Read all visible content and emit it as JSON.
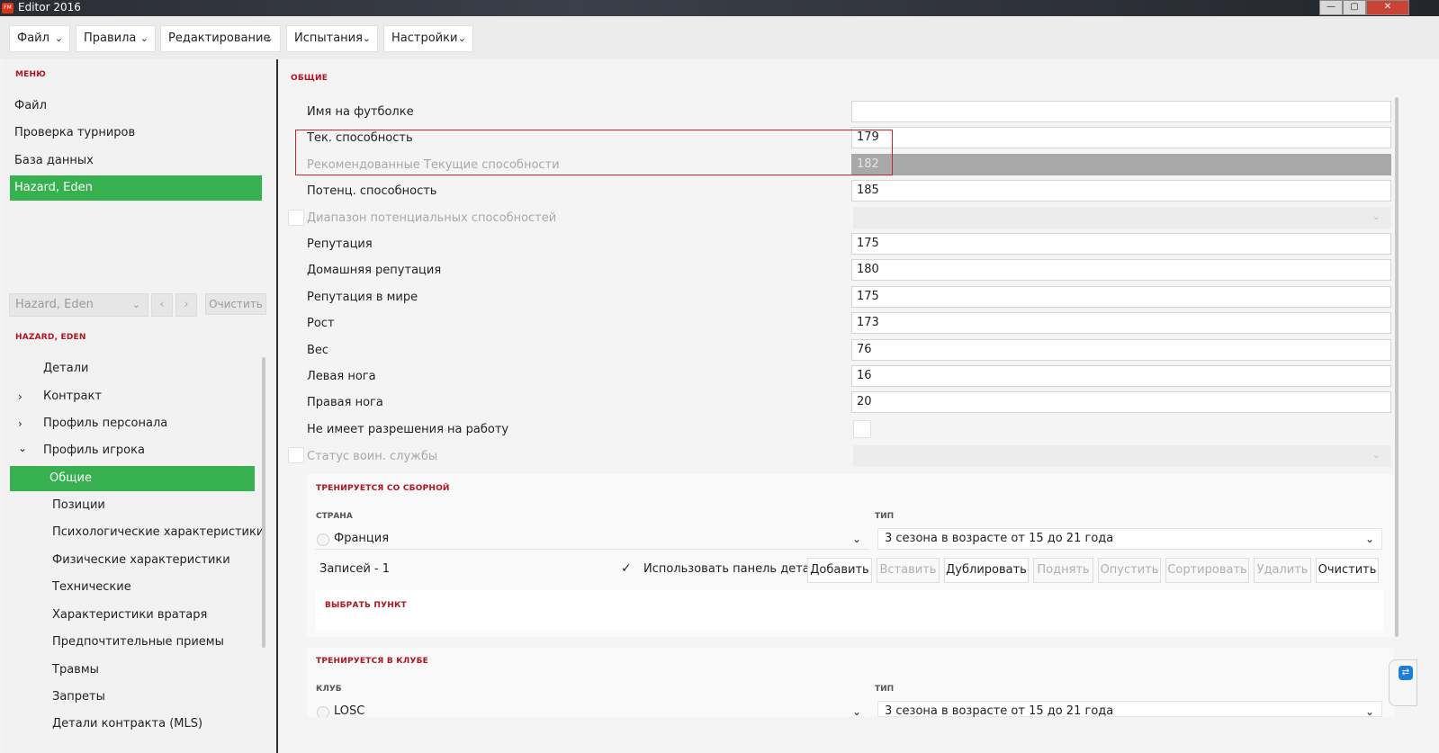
{
  "window": {
    "title": "Editor 2016",
    "app_icon": "FM",
    "minimize": "—",
    "maximize": "▢",
    "close": "✕"
  },
  "menubar": [
    {
      "label": "Файл"
    },
    {
      "label": "Правила"
    },
    {
      "label": "Редактирование"
    },
    {
      "label": "Испытания"
    },
    {
      "label": "Настройки"
    }
  ],
  "sidebar": {
    "menu_label": "МЕНЮ",
    "items": [
      "Файл",
      "Проверка турниров",
      "База данных",
      "Hazard, Eden"
    ],
    "search_value": "Hazard, Eden",
    "clear_label": "Очистить",
    "player_label": "HAZARD, EDEN",
    "tree": [
      {
        "label": "Детали",
        "chevron": ""
      },
      {
        "label": "Контракт",
        "chevron": "›"
      },
      {
        "label": "Профиль персонала",
        "chevron": "›"
      },
      {
        "label": "Профиль игрока",
        "chevron": "⌄"
      },
      {
        "label": "Общие",
        "chevron": ""
      },
      {
        "label": "Позиции",
        "chevron": ""
      },
      {
        "label": "Психологические характеристики",
        "chevron": ""
      },
      {
        "label": "Физические характеристики",
        "chevron": ""
      },
      {
        "label": "Технические",
        "chevron": ""
      },
      {
        "label": "Характеристики вратаря",
        "chevron": ""
      },
      {
        "label": "Предпочтительные приемы",
        "chevron": ""
      },
      {
        "label": "Травмы",
        "chevron": ""
      },
      {
        "label": "Запреты",
        "chevron": ""
      },
      {
        "label": "Детали контракта (MLS)",
        "chevron": ""
      }
    ]
  },
  "main": {
    "section_label": "ОБЩИЕ",
    "fields": [
      {
        "label": "Имя на футболке",
        "value": ""
      },
      {
        "label": "Тек. способность",
        "value": "179"
      },
      {
        "label": "Рекомендованные Текущие способности",
        "value": "182"
      },
      {
        "label": "Потенц. способность",
        "value": "185"
      },
      {
        "label": "Диапазон потенциальных способностей",
        "value": ""
      },
      {
        "label": "Репутация",
        "value": "175"
      },
      {
        "label": "Домашняя репутация",
        "value": "180"
      },
      {
        "label": "Репутация в мире",
        "value": "175"
      },
      {
        "label": "Рост",
        "value": "173"
      },
      {
        "label": "Вес",
        "value": "76"
      },
      {
        "label": "Левая нога",
        "value": "16"
      },
      {
        "label": "Правая нога",
        "value": "20"
      },
      {
        "label": "Не имеет разрешения на работу",
        "value": ""
      },
      {
        "label": "Статус воин. службы",
        "value": ""
      }
    ],
    "national_training": {
      "title": "ТРЕНИРУЕТСЯ СО СБОРНОЙ",
      "col_country": "СТРАНА",
      "col_type": "ТИП",
      "country": "Франция",
      "type": "3 сезона в возрасте от 15 до 21 года",
      "records": "Записей - 1",
      "use_details_panel": "Использовать панель деталей",
      "buttons": [
        "Добавить",
        "Вставить",
        "Дублировать",
        "Поднять",
        "Опустить",
        "Сортировать",
        "Удалить",
        "Очистить"
      ],
      "select_item": "ВЫБРАТЬ ПУНКТ"
    },
    "club_training": {
      "title": "ТРЕНИРУЕТСЯ В КЛУБЕ",
      "col_club": "КЛУБ",
      "col_type": "ТИП",
      "club": "LOSC",
      "type": "3 сезона в возрасте от 15 до 21 года"
    }
  },
  "colors": {
    "accent_green": "#37b14f",
    "section_red": "#b1141e",
    "highlight_red": "#c4282f"
  }
}
